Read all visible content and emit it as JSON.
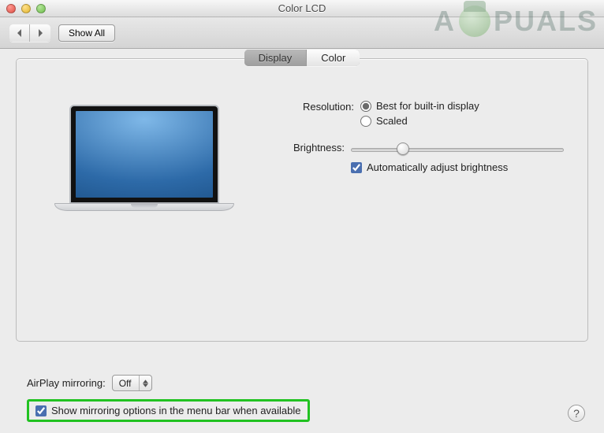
{
  "window": {
    "title": "Color LCD"
  },
  "toolbar": {
    "show_all": "Show All"
  },
  "tabs": {
    "display": "Display",
    "color": "Color",
    "active": "display"
  },
  "resolution": {
    "label": "Resolution:",
    "best": "Best for built-in display",
    "scaled": "Scaled",
    "selected": "best"
  },
  "brightness": {
    "label": "Brightness:",
    "auto": "Automatically adjust brightness",
    "auto_checked": true,
    "value_pct": 24
  },
  "airplay": {
    "label": "AirPlay mirroring:",
    "value": "Off"
  },
  "mirroring": {
    "label": "Show mirroring options in the menu bar when available",
    "checked": true
  },
  "help": "?",
  "watermark": {
    "left": "A",
    "right": "PUALS"
  }
}
